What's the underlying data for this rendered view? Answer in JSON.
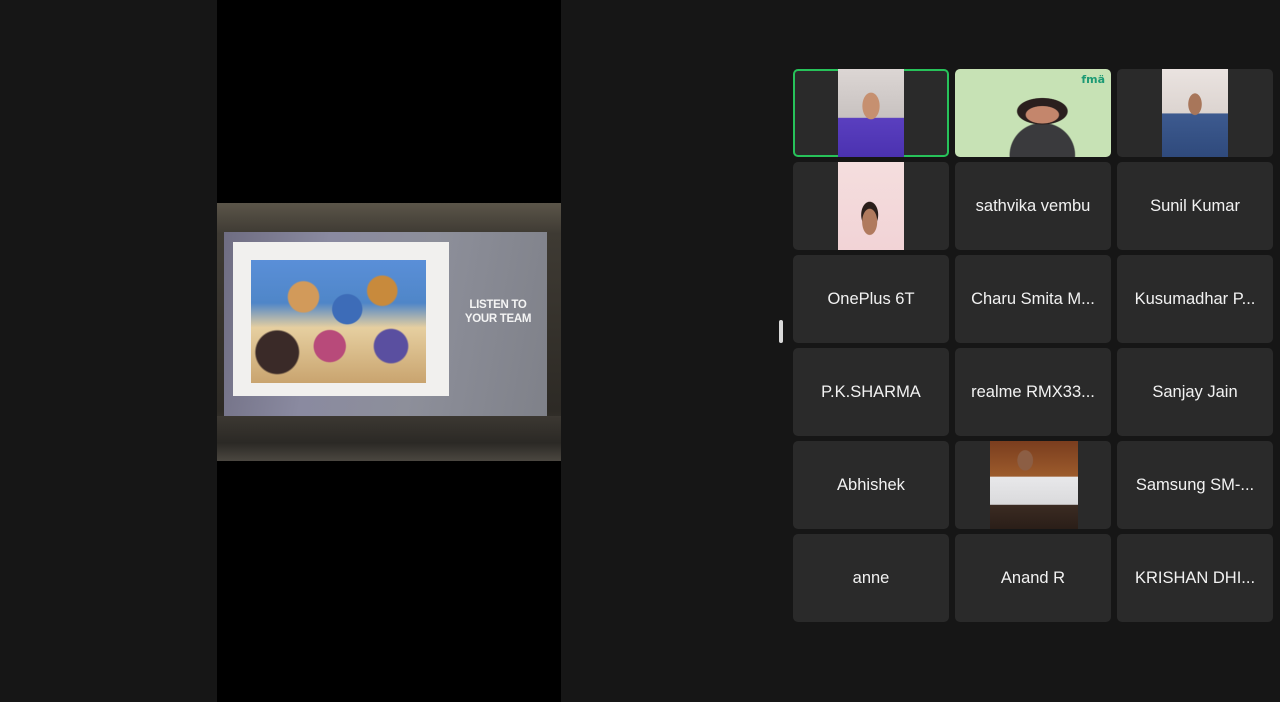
{
  "shared_screen": {
    "slide_text_line1": "LISTEN TO",
    "slide_text_line2": "YOUR TEAM"
  },
  "participants": [
    {
      "name": "",
      "video": true,
      "active_speaker": true
    },
    {
      "name": "",
      "video": true,
      "logo_text": "fmä"
    },
    {
      "name": "",
      "video": true
    },
    {
      "name": "",
      "video": true
    },
    {
      "name": "sathvika vembu",
      "video": false
    },
    {
      "name": "Sunil Kumar",
      "video": false
    },
    {
      "name": "OnePlus 6T",
      "video": false
    },
    {
      "name": "Charu Smita M...",
      "video": false
    },
    {
      "name": "Kusumadhar P...",
      "video": false
    },
    {
      "name": "P.K.SHARMA",
      "video": false
    },
    {
      "name": "realme RMX33...",
      "video": false
    },
    {
      "name": "Sanjay Jain",
      "video": false
    },
    {
      "name": "Abhishek",
      "video": false
    },
    {
      "name": "",
      "video": true
    },
    {
      "name": "Samsung SM-...",
      "video": false
    },
    {
      "name": "anne",
      "video": false
    },
    {
      "name": "Anand R",
      "video": false
    },
    {
      "name": "KRISHAN DHI...",
      "video": false
    }
  ],
  "colors": {
    "background": "#161616",
    "tile": "#2a2a2a",
    "active_speaker_border": "#27c25a"
  }
}
